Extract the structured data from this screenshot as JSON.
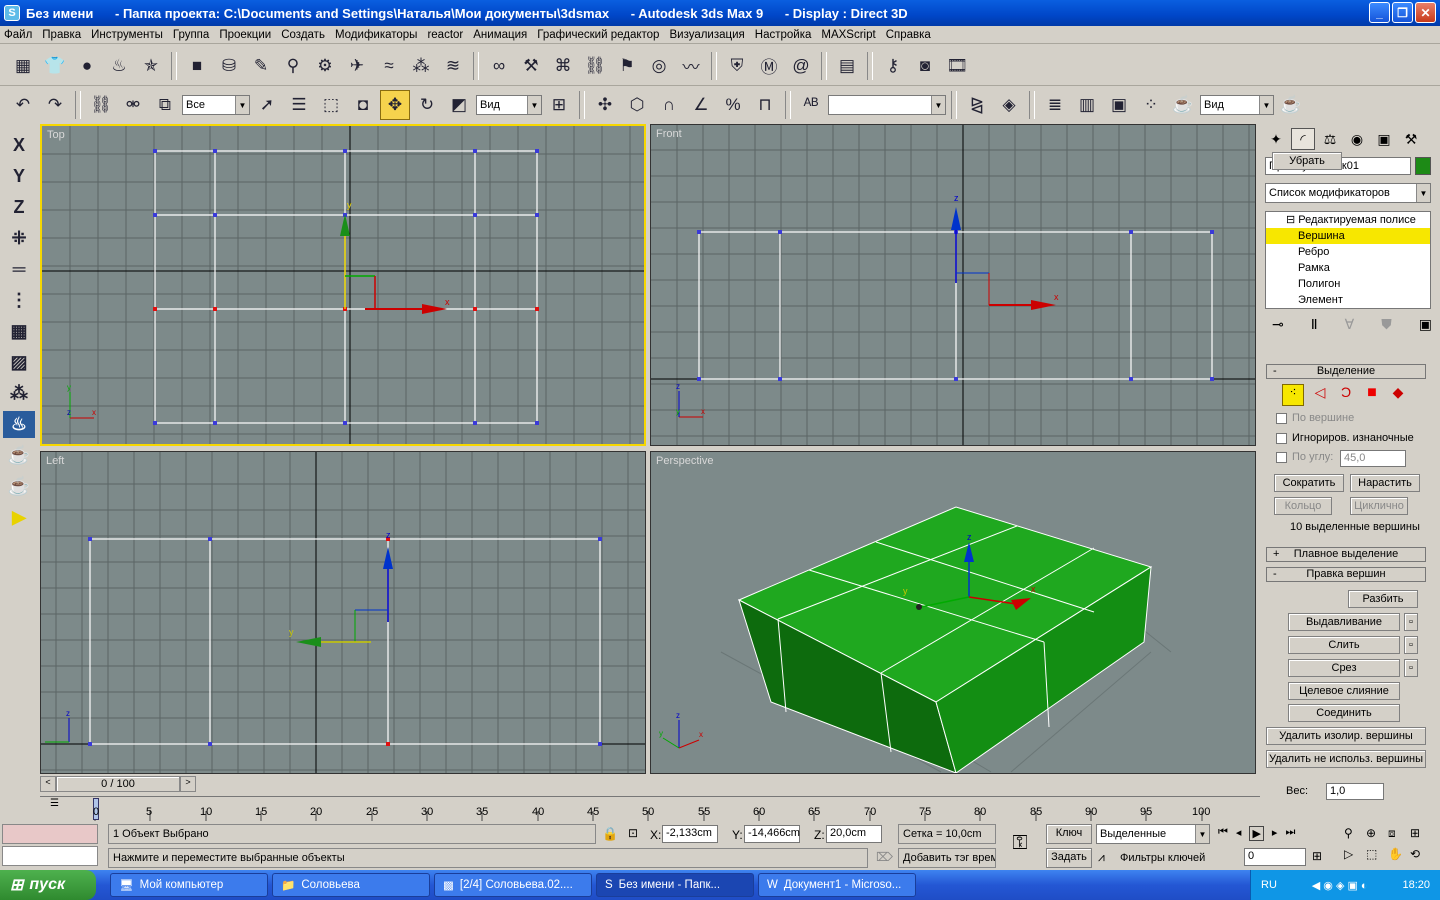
{
  "window": {
    "title": "Без имени      - Папка проекта: C:\\Documents and Settings\\Наталья\\Мои документы\\3dsmax      - Autodesk 3ds Max 9      - Display : Direct 3D",
    "buttons": [
      "_",
      "❐",
      "✕"
    ]
  },
  "menu": [
    "Файл",
    "Правка",
    "Инструменты",
    "Группа",
    "Проекции",
    "Создать",
    "Модификаторы",
    "reactor",
    "Анимация",
    "Графический редактор",
    "Визуализация",
    "Настройка",
    "MAXScript",
    "Справка"
  ],
  "toolbar": {
    "selection_filter": "Все",
    "ref_coord": "Вид",
    "named_selection": "",
    "render_view": "Вид"
  },
  "viewports": {
    "top": "Top",
    "front": "Front",
    "left": "Left",
    "perspective": "Perspective"
  },
  "command_panel": {
    "object_name": "Прямоугольник01",
    "object_color": "#1d8a16",
    "modifier_list": "Список модификаторов",
    "stack": [
      "Редактируемая полисе",
      "Вершина",
      "Ребро",
      "Рамка",
      "Полигон",
      "Элемент"
    ],
    "selection": {
      "title": "Выделение",
      "by_vertex": "По вершине",
      "ignore_backfacing": "Игнориров. изнаночные",
      "by_angle": "По углу:",
      "angle_value": "45,0",
      "shrink": "Сократить",
      "grow": "Нарастить",
      "ring": "Кольцо",
      "loop": "Циклично",
      "status": "10 выделенные вершины"
    },
    "soft_selection": "Плавное выделение",
    "edit_vertices": {
      "title": "Правка вершин",
      "remove": "Убрать",
      "break": "Разбить",
      "extrude": "Выдавливание",
      "weld": "Слить",
      "chamfer": "Срез",
      "target_weld": "Целевое слияние",
      "connect": "Соединить",
      "remove_isolated": "Удалить изолир. вершины",
      "remove_unused": "Удалить не использ. вершины",
      "weight_label": "Вес:",
      "weight_value": "1,0"
    }
  },
  "timeline": {
    "position": "0 / 100",
    "ticks": [
      "0",
      "5",
      "10",
      "15",
      "20",
      "25",
      "30",
      "35",
      "40",
      "45",
      "50",
      "55",
      "60",
      "65",
      "70",
      "75",
      "80",
      "85",
      "90",
      "95",
      "100"
    ]
  },
  "status": {
    "selected": "1 Объект Выбрано",
    "prompt": "Нажмите и переместите выбранные объекты",
    "x_label": "X:",
    "x_value": "-2,133cm",
    "y_label": "Y:",
    "y_value": "-14,466cm",
    "z_label": "Z:",
    "z_value": "20,0cm",
    "grid": "Сетка = 10,0cm",
    "add_time_tag": "Добавить тэг врем",
    "key_btn": "Ключ",
    "set_btn": "Задать",
    "key_mode": "Выделенные",
    "key_filters": "Фильтры ключей",
    "frame": "0"
  },
  "taskbar": {
    "start": "пуск",
    "tasks": [
      "Мой компьютер",
      "Соловьева",
      "[2/4] Соловьева.02....",
      "Без имени    - Папк...",
      "Документ1 - Microso..."
    ],
    "lang": "RU",
    "clock": "18:20"
  }
}
